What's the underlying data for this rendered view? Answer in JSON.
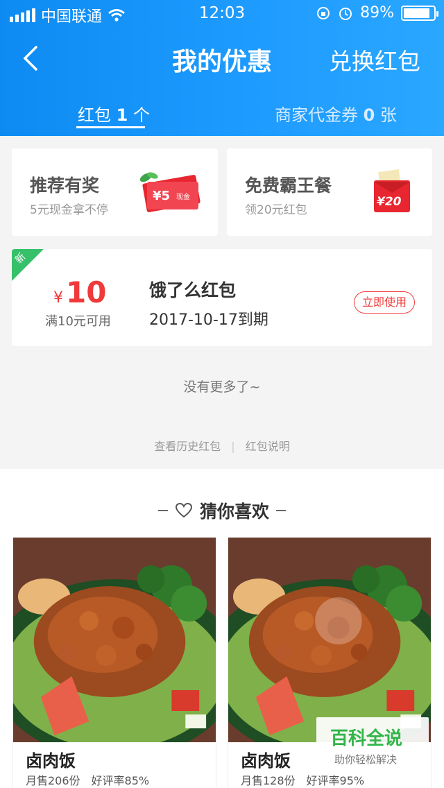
{
  "status_bar": {
    "carrier": "中国联通",
    "time": "12:03",
    "battery": "89%",
    "battery_level": 0.89
  },
  "header": {
    "title": "我的优惠",
    "redeem_label": "兑换红包"
  },
  "tabs": [
    {
      "prefix": "红包",
      "count": "1",
      "suffix": "个"
    },
    {
      "prefix": "商家代金券",
      "count": "0",
      "suffix": "张"
    }
  ],
  "promos": [
    {
      "title": "推荐有奖",
      "subtitle": "5元现金拿不停",
      "image_text": "¥5",
      "image_sub": "现金"
    },
    {
      "title": "免费霸王餐",
      "subtitle": "领20元红包",
      "image_text": "¥20"
    }
  ],
  "coupon": {
    "badge": "新",
    "currency": "¥",
    "amount": "10",
    "condition": "满10元可用",
    "name": "饿了么红包",
    "expiry": "2017-10-17到期",
    "action": "立即使用"
  },
  "no_more": "没有更多了~",
  "footer_links": {
    "history": "查看历史红包",
    "separator": "|",
    "explain": "红包说明"
  },
  "guess": {
    "title": "猜你喜欢",
    "items": [
      {
        "name": "卤肉饭",
        "sales": "月售206份",
        "rating": "好评率85%"
      },
      {
        "name": "卤肉饭",
        "sales": "月售128份",
        "rating": "好评率95%"
      }
    ]
  },
  "watermark": {
    "title": "百科全说",
    "subtitle": "助你轻松解决"
  },
  "colors": {
    "brand_blue": "#1a96fb",
    "red": "#f03a3a",
    "green": "#36c06a"
  }
}
